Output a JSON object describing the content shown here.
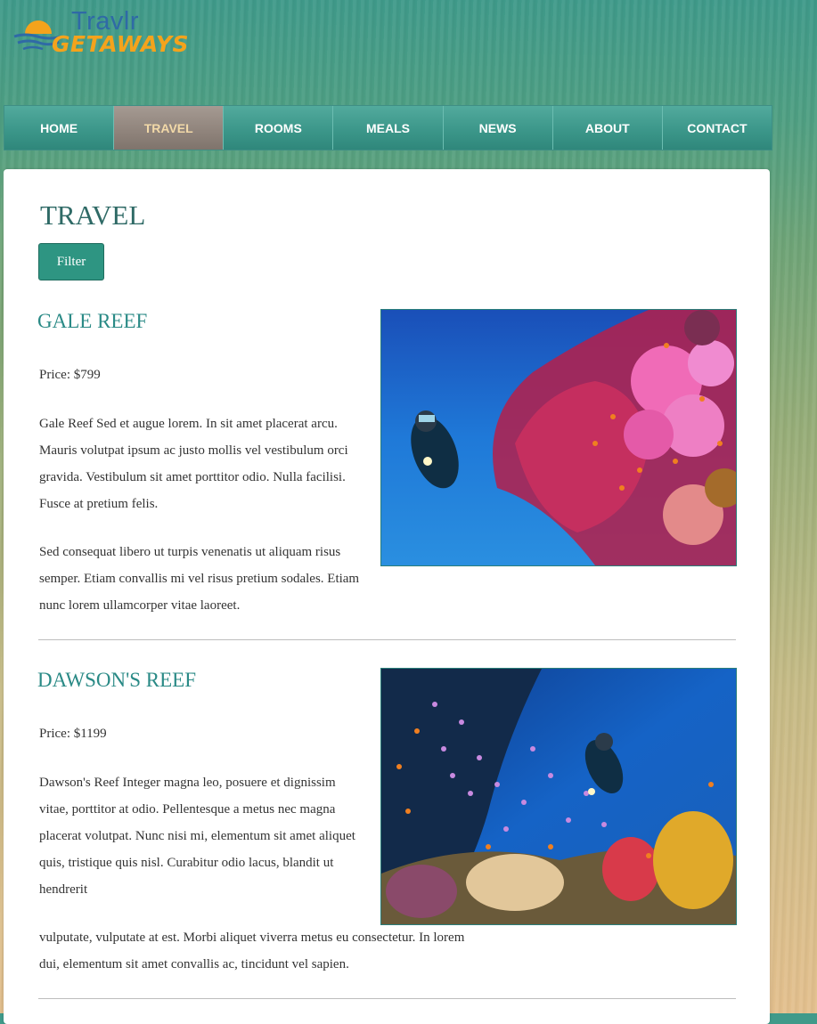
{
  "logo": {
    "line1": "Travlr",
    "line2": "GETAWAYS"
  },
  "nav": [
    {
      "label": "HOME"
    },
    {
      "label": "TRAVEL",
      "active": true
    },
    {
      "label": "ROOMS"
    },
    {
      "label": "MEALS"
    },
    {
      "label": "NEWS"
    },
    {
      "label": "ABOUT"
    },
    {
      "label": "CONTACT"
    }
  ],
  "page": {
    "title": "TRAVEL",
    "filter_label": "Filter"
  },
  "trips": [
    {
      "name": "GALE REEF",
      "price": "Price: $799",
      "paragraphs": [
        "Gale Reef Sed et augue lorem. In sit amet placerat arcu. Mauris volutpat ipsum ac justo mollis vel vestibulum orci gravida. Vestibulum sit amet porttitor odio. Nulla facilisi. Fusce at pretium felis.",
        "Sed consequat libero ut turpis venenatis ut aliquam risus semper. Etiam convallis mi vel risus pretium sodales. Etiam nunc lorem ullamcorper vitae laoreet."
      ],
      "image": "coral-reef-diver-photo"
    },
    {
      "name": "DAWSON'S REEF",
      "price": "Price: $1199",
      "paragraphs": [
        "Dawson's Reef Integer magna leo, posuere et dignissim vitae, porttitor at odio. Pellentesque a metus nec magna placerat volutpat. Nunc nisi mi, elementum sit amet aliquet quis, tristique quis nisl. Curabitur odio lacus, blandit ut hendrerit",
        "vulputate, vulputate at est. Morbi aliquet viverra metus eu consectetur. In lorem dui, elementum sit amet convallis ac, tincidunt vel sapien."
      ],
      "image": "reef-fish-diver-photo"
    }
  ],
  "colors": {
    "accent": "#2e9582",
    "nav": "#3c978a",
    "nav_active": "#8f837b",
    "heading": "#2a8a86"
  }
}
